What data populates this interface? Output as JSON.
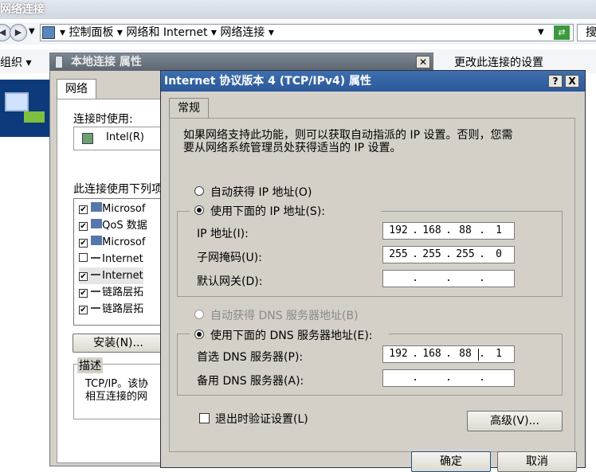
{
  "explorer": {
    "title": "网络连接",
    "breadcrumb": [
      "控制面板",
      "网络和 Internet",
      "网络连接"
    ],
    "search_label": "搜",
    "organize": "组织",
    "change_settings": "更改此连接的设置"
  },
  "local_dialog": {
    "title": "本地连接 属性",
    "tab": "网络",
    "connect_using_label": "连接时使用:",
    "adapter": "Intel(R)",
    "items_label": "此连接使用下列项",
    "items": [
      {
        "checked": true,
        "label": "Microsof"
      },
      {
        "checked": true,
        "label": "QoS 数据"
      },
      {
        "checked": true,
        "label": "Microsof"
      },
      {
        "checked": false,
        "label": "Internet"
      },
      {
        "checked": true,
        "label": "Internet"
      },
      {
        "checked": true,
        "label": "链路层拓"
      },
      {
        "checked": true,
        "label": "链路层拓"
      }
    ],
    "install_button": "安装(N)...",
    "desc_legend": "描述",
    "desc_text_1": "TCP/IP。该协",
    "desc_text_2": "相互连接的网"
  },
  "ipv4_dialog": {
    "title": "Internet 协议版本 4 (TCP/IPv4) 属性",
    "help": "?",
    "close": "X",
    "tab": "常规",
    "intro_1": "如果网络支持此功能，则可以获取自动指派的 IP 设置。否则，您需",
    "intro_2": "要从网络系统管理员处获得适当的 IP 设置。",
    "auto_ip": "自动获得 IP 地址(O)",
    "manual_ip": "使用下面的 IP 地址(S):",
    "ip_label": "IP 地址(I):",
    "ip": [
      "192",
      "168",
      "88",
      "1"
    ],
    "mask_label": "子网掩码(U):",
    "mask": [
      "255",
      "255",
      "255",
      "0"
    ],
    "gateway_label": "默认网关(D):",
    "gateway": [
      "",
      "",
      "",
      ""
    ],
    "auto_dns": "自动获得 DNS 服务器地址(B)",
    "manual_dns": "使用下面的 DNS 服务器地址(E):",
    "dns1_label": "首选 DNS 服务器(P):",
    "dns1": [
      "192",
      "168",
      "88",
      "1"
    ],
    "dns2_label": "备用 DNS 服务器(A):",
    "dns2": [
      "",
      "",
      "",
      ""
    ],
    "validate_label": "退出时验证设置(L)",
    "advanced_button": "高级(V)...",
    "ok_button": "确定",
    "cancel_button": "取消"
  }
}
